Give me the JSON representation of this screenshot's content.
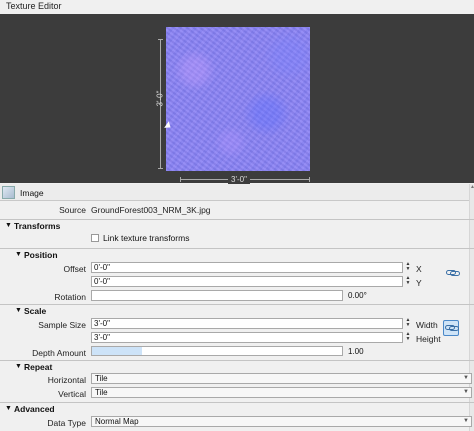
{
  "window": {
    "title": "Texture Editor"
  },
  "preview": {
    "height_label": "3'-0\"",
    "width_label": "3'-0\""
  },
  "image_tab": {
    "label": "Image"
  },
  "source": {
    "label": "Source",
    "value": "GroundForest003_NRM_3K.jpg"
  },
  "transforms": {
    "title": "Transforms",
    "link_label": "Link texture transforms",
    "link_checked": false
  },
  "position": {
    "title": "Position",
    "offset_label": "Offset",
    "offset_x": "0'-0\"",
    "offset_y": "0'-0\"",
    "x_label": "X",
    "y_label": "Y",
    "rotation_label": "Rotation",
    "rotation_value": "0.00°"
  },
  "scale": {
    "title": "Scale",
    "sample_size_label": "Sample Size",
    "width_value": "3'-0\"",
    "height_value": "3'-0\"",
    "width_label": "Width",
    "height_label": "Height",
    "depth_label": "Depth Amount",
    "depth_value": "1.00",
    "depth_fraction": 0.2
  },
  "repeat": {
    "title": "Repeat",
    "horizontal_label": "Horizontal",
    "horizontal_value": "Tile",
    "vertical_label": "Vertical",
    "vertical_value": "Tile"
  },
  "advanced": {
    "title": "Advanced",
    "data_type_label": "Data Type",
    "data_type_value": "Normal Map"
  },
  "colors": {
    "preview_bg": "#3c3c3c",
    "texture": "#8a84f4",
    "accent": "#4a88c8"
  }
}
